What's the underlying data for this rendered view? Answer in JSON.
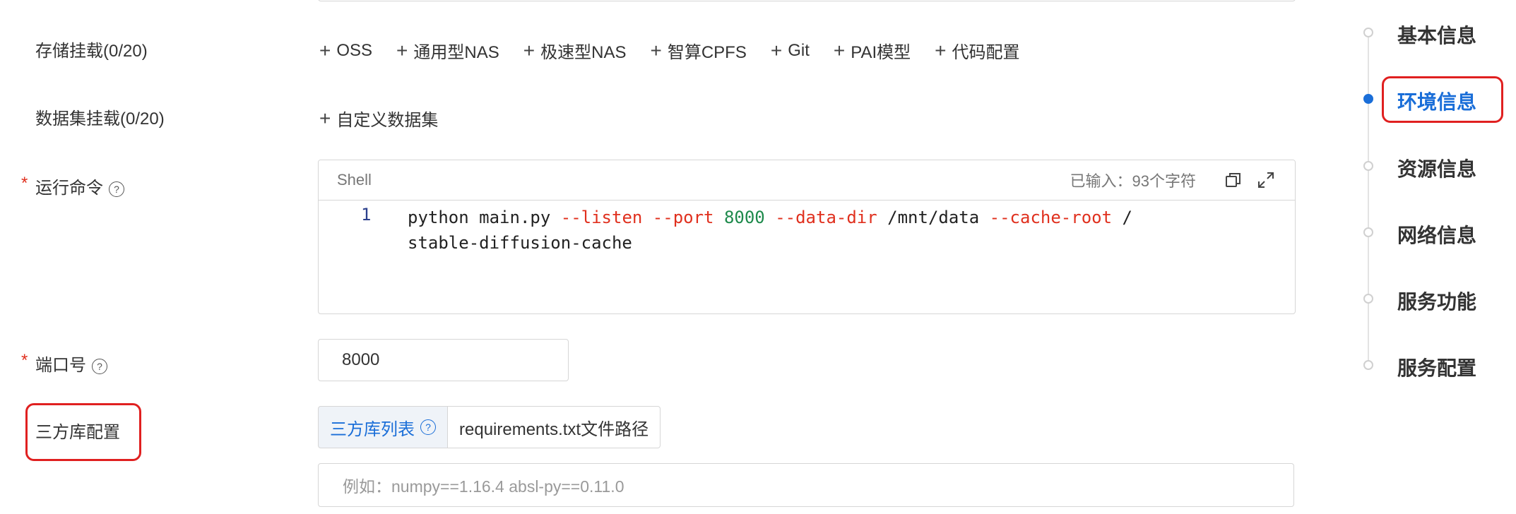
{
  "storage": {
    "label": "存储挂载(0/20)",
    "buttons": [
      "OSS",
      "通用型NAS",
      "极速型NAS",
      "智算CPFS",
      "Git",
      "PAI模型",
      "代码配置"
    ]
  },
  "dataset": {
    "label": "数据集挂载(0/20)",
    "button": "自定义数据集"
  },
  "command": {
    "required_mark": "*",
    "label": "运行命令",
    "language": "Shell",
    "char_count": "已输入：93个字符",
    "line_number": "1",
    "code_tokens": [
      "python main.py ",
      "--listen",
      " ",
      "--port",
      " ",
      "8000",
      " ",
      "--data-dir",
      " /mnt/data ",
      "--cache-root",
      " /"
    ],
    "code_line2": "stable-diffusion-cache"
  },
  "port": {
    "required_mark": "*",
    "label": "端口号",
    "value": "8000"
  },
  "thirdparty": {
    "label": "三方库配置",
    "tab_list": "三方库列表",
    "tab_path": "requirements.txt文件路径",
    "placeholder": "例如：numpy==1.16.4 absl-py==0.11.0"
  },
  "nav": {
    "items": [
      "基本信息",
      "环境信息",
      "资源信息",
      "网络信息",
      "服务功能",
      "服务配置"
    ],
    "active_index": 1
  },
  "colors": {
    "accent": "#1a6ed8",
    "highlight_box": "#e02020",
    "code_flag": "#e0301e",
    "code_number": "#1e8a4c"
  }
}
